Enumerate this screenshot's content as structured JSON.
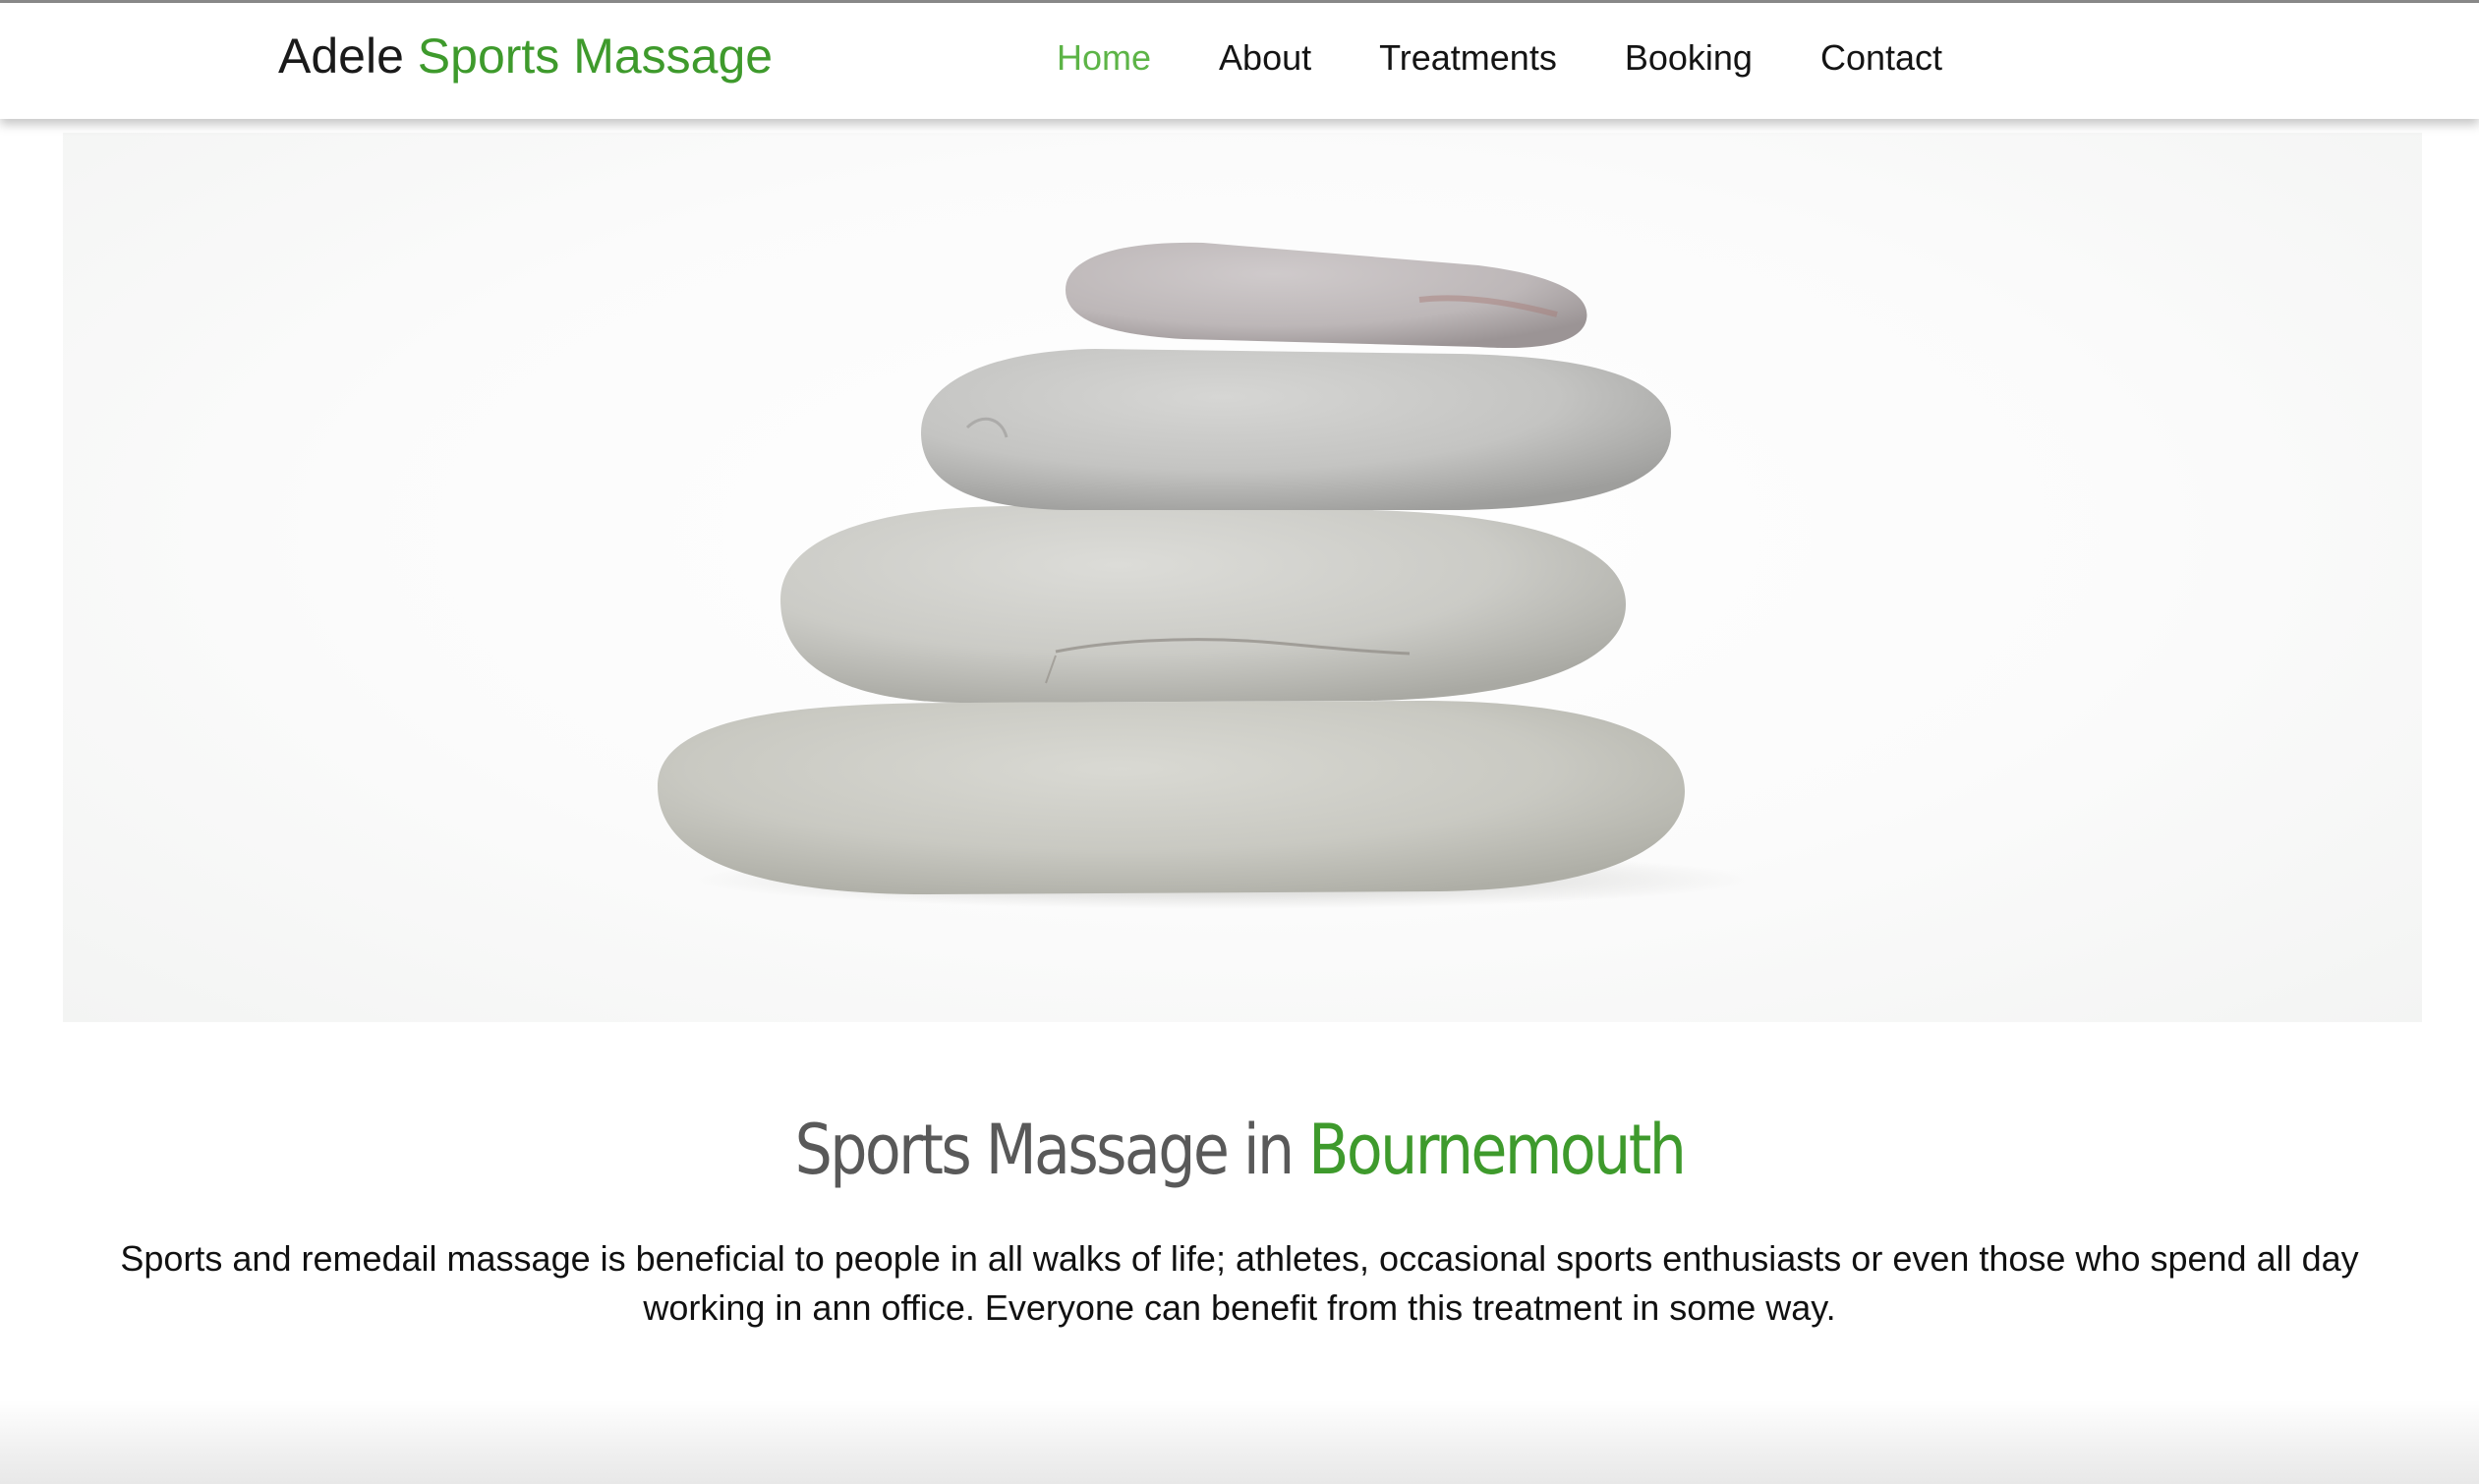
{
  "header": {
    "logo_first": "Adele",
    "logo_accent": "Sports Massage",
    "nav": [
      {
        "label": "Home",
        "active": true
      },
      {
        "label": "About",
        "active": false
      },
      {
        "label": "Treatments",
        "active": false
      },
      {
        "label": "Booking",
        "active": false
      },
      {
        "label": "Contact",
        "active": false
      }
    ]
  },
  "hero": {
    "image": "stacked-stones"
  },
  "main": {
    "headline_main": "Sports Massage in",
    "headline_accent": "Bournemouth",
    "intro": "Sports and remedail massage is beneficial to people in all walks of life; athletes, occasional sports enthusiasts or even those who spend all day working in ann office. Everyone can benefit from this treatment in some way."
  },
  "colors": {
    "accent": "#3e9a2c",
    "nav_active": "#5db447",
    "heading_gray": "#595959"
  }
}
